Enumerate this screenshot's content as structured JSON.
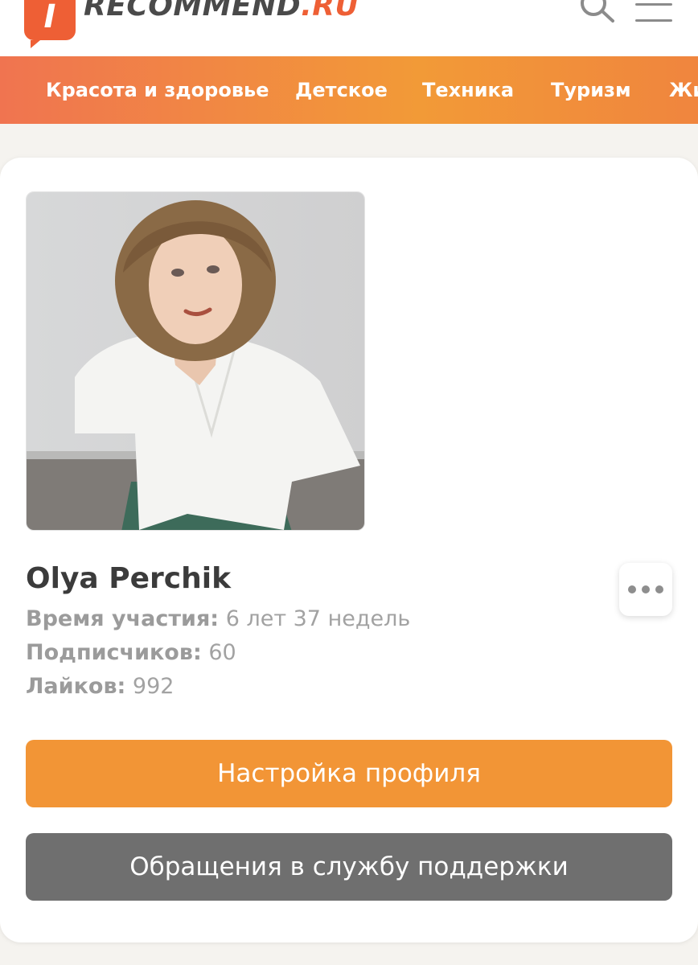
{
  "header": {
    "logo_mark": "I",
    "logo_word": "RECOMMEND",
    "logo_tld": ".RU",
    "search_icon": "search-icon",
    "menu_icon": "hamburger-menu-icon"
  },
  "categories": [
    {
      "label": "Красота и здоровье"
    },
    {
      "label": "Детское"
    },
    {
      "label": "Техника"
    },
    {
      "label": "Туризм"
    },
    {
      "label": "Жи"
    }
  ],
  "profile": {
    "name": "Olya Perchik",
    "stats": [
      {
        "label": "Время участия:",
        "value": "6 лет 37 недель"
      },
      {
        "label": "Подписчиков:",
        "value": "60"
      },
      {
        "label": "Лайков:",
        "value": "992"
      }
    ],
    "more_icon": "more-dots-icon"
  },
  "buttons": {
    "settings": "Настройка профиля",
    "support": "Обращения в службу поддержки"
  },
  "colors": {
    "brand_orange": "#f29536",
    "brand_red": "#ee5f35",
    "secondary_gray": "#6f6f6f"
  }
}
